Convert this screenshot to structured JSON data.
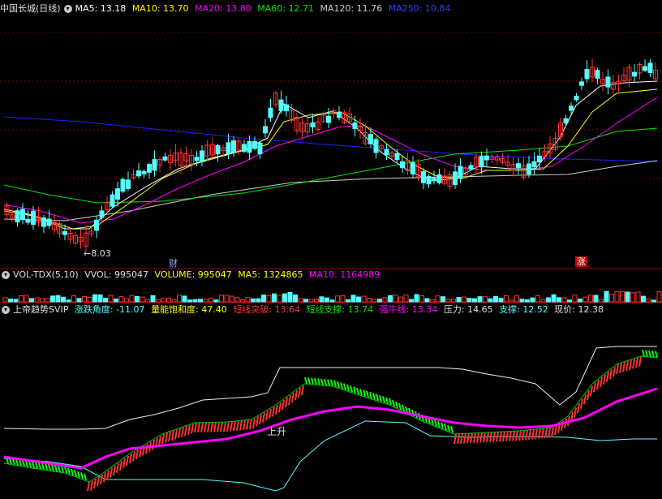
{
  "panel_main": {
    "title": "中国长城(日线)",
    "ma5": "MA5: 13.18",
    "ma10": "MA10: 13.70",
    "ma20": "MA20: 13.80",
    "ma60": "MA60: 12.71",
    "ma120": "MA120: 11.76",
    "ma250": "MA250: 10.84",
    "low_marker": "8.03",
    "event_cai": "财",
    "event_zhang": "涨"
  },
  "panel_volume": {
    "title": "VOL-TDX(5,10)",
    "vvol": "VVOL: 995047",
    "volume": "VOLUME: 995047",
    "ma5": "MA5: 1324865",
    "ma10": "MA10: 1164989"
  },
  "panel_indicator": {
    "title": "上帝趋势SVIP",
    "angle": "涨跌角度: -11.07",
    "saturation": "量能饱和度: 47.40",
    "breakout": "短线突破: 13.64",
    "support_short": "短线支撑: 13.74",
    "bull_line": "强牛线: 13.34",
    "pressure": "压力: 14.65",
    "support": "支撑: 12.52",
    "price": "现价: 12.38",
    "rise_label": "上升"
  },
  "colors": {
    "up": "#ff3232",
    "down": "#54ffff",
    "ma5": "#ffffff",
    "ma10": "#ffff00",
    "ma20": "#ff00ff",
    "ma60": "#00e600",
    "ma120": "#d0d0d0",
    "ma250": "#2020ff",
    "grid": "#7a0000"
  }
}
